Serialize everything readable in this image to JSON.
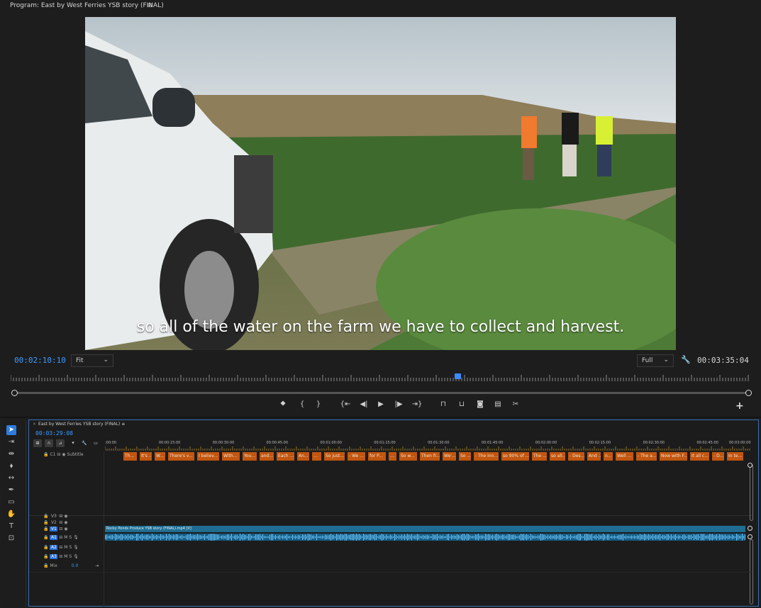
{
  "monitor": {
    "title": "Program: East by West Ferries YSB story (FINAL)",
    "menu_icon": "hamburger-icon",
    "caption": "so all of the water on the farm we have to collect and harvest.",
    "current_timecode": "00:02:10:10",
    "zoom_value": "Fit",
    "resolution_value": "Full",
    "duration_timecode": "00:03:35:04",
    "playhead_fraction": 0.605,
    "transport_icons": [
      "marker-icon",
      "mark-in-icon",
      "mark-out-icon",
      "go-to-in-icon",
      "step-back-icon",
      "play-icon",
      "step-forward-icon",
      "go-to-out-icon",
      "lift-icon",
      "extract-icon",
      "export-frame-icon",
      "comparison-view-icon",
      "trim-icon"
    ],
    "add_button": "+"
  },
  "timeline": {
    "sequence_name": "East by West Ferries YSB story (FINAL)",
    "sequence_timecode": "00:03:29:08",
    "ruler_labels": [
      ":00:00",
      "00:00:15:00",
      "00:00:30:00",
      "00:00:45:00",
      "00:01:00:00",
      "00:01:15:00",
      "00:01:30:00",
      "00:01:45:00",
      "00:02:00:00",
      "00:02:15:00",
      "00:02:30:00",
      "00:02:45:00",
      "00:03:00:00"
    ],
    "subtitle_track": {
      "name": "C1",
      "label": "Subtitle"
    },
    "subtitle_clips": [
      "Th...",
      "It's ...",
      "W...",
      "There's v...",
      "I believ...",
      "With...",
      "You...",
      "and...",
      "Each ...",
      "An...",
      "...",
      "So just...",
      "- We ...",
      "for P...",
      "...",
      "So w...",
      "Then fr...",
      "We'...",
      "So ...",
      "- The inn...",
      "so 90% of ...",
      "The ...",
      "so all...",
      "- Des...",
      "And ...",
      "n...",
      "Well ...",
      "- The a...",
      "Now with F...",
      "It all c...",
      "- D...",
      "In te..."
    ],
    "video_tracks": [
      {
        "name": "V3"
      },
      {
        "name": "V2"
      },
      {
        "name": "V1"
      }
    ],
    "v1_clip_name": "Rocky Ponds Produce YSB story (FINAL).mp4 [V]",
    "audio_tracks": [
      {
        "name": "A1"
      },
      {
        "name": "A2"
      },
      {
        "name": "A3"
      }
    ],
    "mix_label": "Mix",
    "mix_value": "0.0",
    "tools": [
      "selection-tool-icon",
      "track-select-tool-icon",
      "ripple-edit-tool-icon",
      "razor-tool-icon",
      "slip-tool-icon",
      "pen-tool-icon",
      "rectangle-tool-icon",
      "hand-tool-icon",
      "type-tool-icon",
      "caption-tool-icon"
    ]
  }
}
